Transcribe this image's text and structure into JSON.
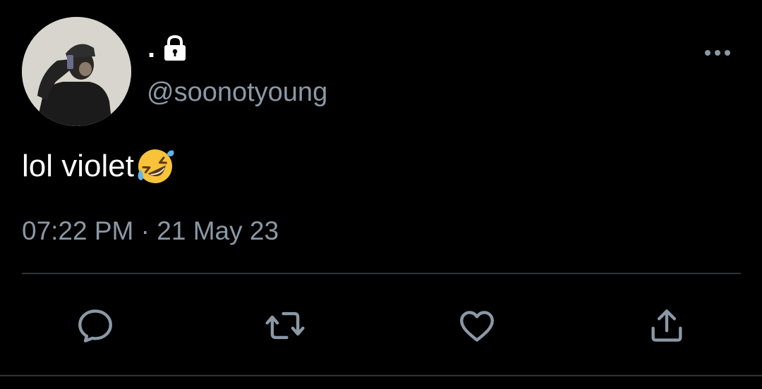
{
  "tweet": {
    "display_name": ".",
    "handle": "@soonotyoung",
    "text": "lol violet",
    "time": "07:22 PM",
    "separator": "·",
    "date": "21 May 23",
    "emoji_icon": "rolling-on-the-floor-laughing-emoji",
    "lock_icon": "lock-icon"
  },
  "actions": [
    {
      "name": "reply",
      "icon": "reply-icon"
    },
    {
      "name": "retweet",
      "icon": "retweet-icon"
    },
    {
      "name": "like",
      "icon": "heart-icon"
    },
    {
      "name": "share",
      "icon": "share-icon"
    }
  ],
  "colors": {
    "background": "#000000",
    "text": "#ffffff",
    "secondary": "#8b98a5",
    "divider": "#2f3336"
  }
}
